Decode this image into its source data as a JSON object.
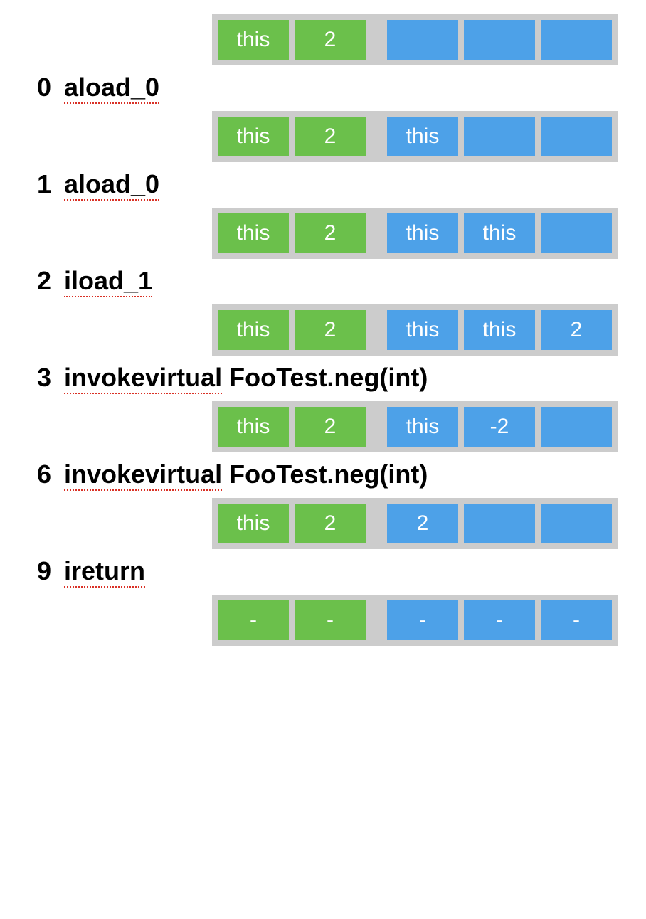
{
  "steps": [
    {
      "locals": [
        "this",
        "2"
      ],
      "stack": [
        "",
        "",
        ""
      ]
    },
    {
      "index": "0",
      "opcode": "aload_0",
      "operand": "",
      "locals": [
        "this",
        "2"
      ],
      "stack": [
        "this",
        "",
        ""
      ]
    },
    {
      "index": "1",
      "opcode": "aload_0",
      "operand": "",
      "locals": [
        "this",
        "2"
      ],
      "stack": [
        "this",
        "this",
        ""
      ]
    },
    {
      "index": "2",
      "opcode": "iload_1",
      "operand": "",
      "locals": [
        "this",
        "2"
      ],
      "stack": [
        "this",
        "this",
        "2"
      ]
    },
    {
      "index": "3",
      "opcode": "invokevirtual",
      "operand": "FooTest.neg(int)",
      "locals": [
        "this",
        "2"
      ],
      "stack": [
        "this",
        "-2",
        ""
      ]
    },
    {
      "index": "6",
      "opcode": "invokevirtual",
      "operand": "FooTest.neg(int)",
      "locals": [
        "this",
        "2"
      ],
      "stack": [
        "2",
        "",
        ""
      ]
    },
    {
      "index": "9",
      "opcode": "ireturn",
      "operand": "",
      "locals": [
        "-",
        "-"
      ],
      "stack": [
        "-",
        "-",
        "-"
      ]
    }
  ]
}
